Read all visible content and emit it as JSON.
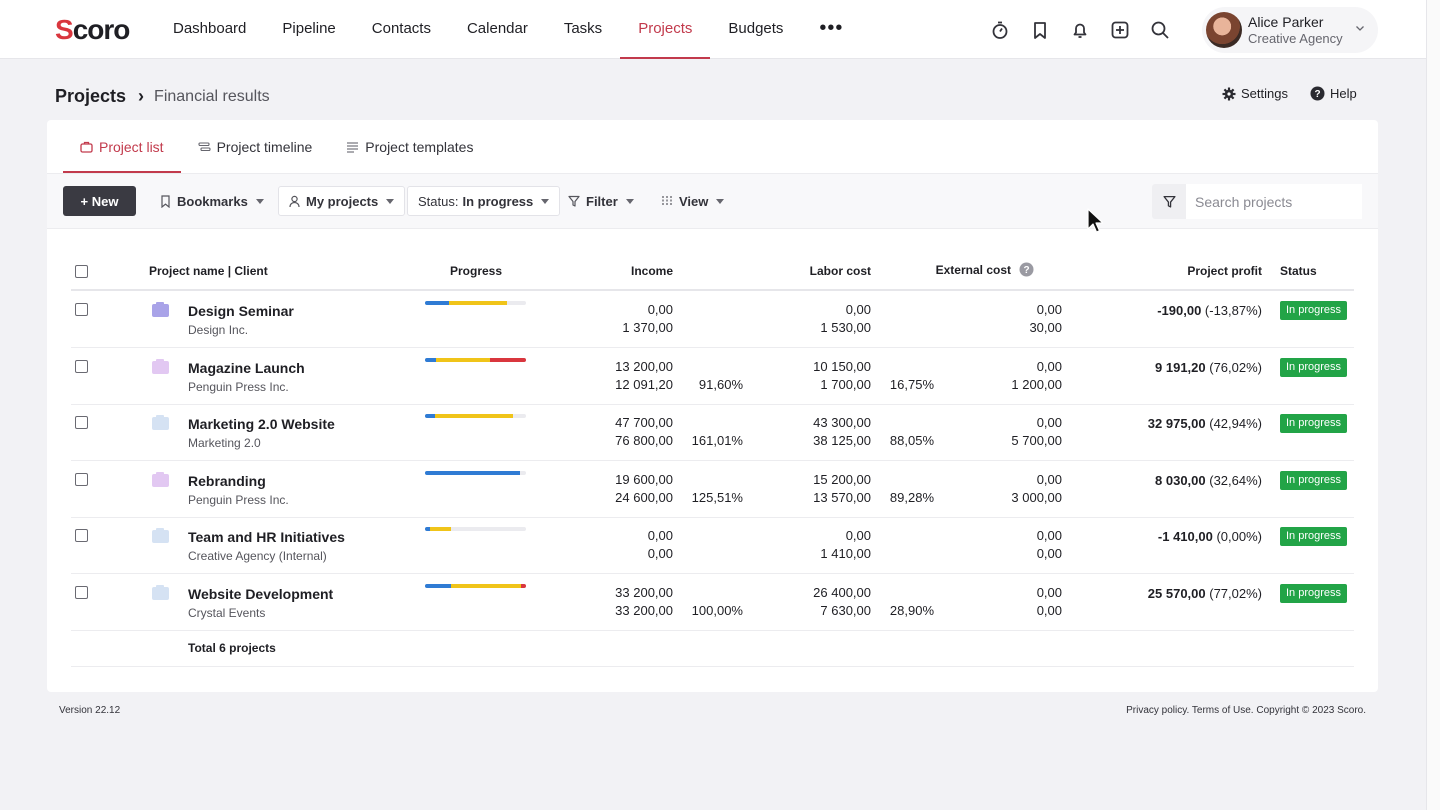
{
  "app": {
    "logo": "Scoro",
    "logo_initial": "S",
    "logo_rest": "coro"
  },
  "nav": {
    "items": [
      "Dashboard",
      "Pipeline",
      "Contacts",
      "Calendar",
      "Tasks",
      "Projects",
      "Budgets"
    ],
    "active": "Projects",
    "more": "•••"
  },
  "top_icons": [
    "stopwatch-icon",
    "bookmark-icon",
    "bell-icon",
    "add-square-icon",
    "search-icon"
  ],
  "user": {
    "name": "Alice Parker",
    "org": "Creative Agency"
  },
  "breadcrumb": {
    "root": "Projects",
    "sep": "›",
    "current": "Financial results"
  },
  "header_actions": {
    "settings": "Settings",
    "help": "Help"
  },
  "tabs": [
    "Project list",
    "Project timeline",
    "Project templates"
  ],
  "toolbar": {
    "new": "+ New",
    "bookmarks": "Bookmarks",
    "my_projects": "My projects",
    "status_label": "Status:",
    "status_value": "In progress",
    "filter": "Filter",
    "view": "View",
    "search_placeholder": "Search projects"
  },
  "table": {
    "headers": [
      "Project name | Client",
      "Progress",
      "Income",
      "Labor cost",
      "External cost",
      "Project profit",
      "Status"
    ],
    "rows": [
      {
        "name": "Design Seminar",
        "client": "Design Inc.",
        "folder_color": "#a9a3e8",
        "progress": [
          {
            "c": "#2f7bd4",
            "w": 0.24
          },
          {
            "c": "#f0c419",
            "w": 0.57
          }
        ],
        "income": [
          "0,00",
          "1 370,00"
        ],
        "income_pct": "",
        "labor": [
          "0,00",
          "1 530,00"
        ],
        "labor_pct": "",
        "external": [
          "0,00",
          "30,00"
        ],
        "profit": "-190,00",
        "profit_pct": "(-13,87%)",
        "status": "In progress"
      },
      {
        "name": "Magazine Launch",
        "client": "Penguin Press Inc.",
        "folder_color": "#e2c8f2",
        "progress": [
          {
            "c": "#2f7bd4",
            "w": 0.11
          },
          {
            "c": "#f0c419",
            "w": 0.53
          },
          {
            "c": "#d9363e",
            "w": 0.36
          }
        ],
        "income": [
          "13 200,00",
          "12 091,20"
        ],
        "income_pct": "91,60%",
        "labor": [
          "10 150,00",
          "1 700,00"
        ],
        "labor_pct": "16,75%",
        "external": [
          "0,00",
          "1 200,00"
        ],
        "profit": "9 191,20",
        "profit_pct": "(76,02%)",
        "status": "In progress"
      },
      {
        "name": "Marketing 2.0 Website",
        "client": "Marketing 2.0",
        "folder_color": "#d5e2f3",
        "progress": [
          {
            "c": "#2f7bd4",
            "w": 0.1
          },
          {
            "c": "#f0c419",
            "w": 0.77
          }
        ],
        "income": [
          "47 700,00",
          "76 800,00"
        ],
        "income_pct": "161,01%",
        "labor": [
          "43 300,00",
          "38 125,00"
        ],
        "labor_pct": "88,05%",
        "external": [
          "0,00",
          "5 700,00"
        ],
        "profit": "32 975,00",
        "profit_pct": "(42,94%)",
        "status": "In progress"
      },
      {
        "name": "Rebranding",
        "client": "Penguin Press Inc.",
        "folder_color": "#e2c8f2",
        "progress": [
          {
            "c": "#2f7bd4",
            "w": 0.94
          }
        ],
        "income": [
          "19 600,00",
          "24 600,00"
        ],
        "income_pct": "125,51%",
        "labor": [
          "15 200,00",
          "13 570,00"
        ],
        "labor_pct": "89,28%",
        "external": [
          "0,00",
          "3 000,00"
        ],
        "profit": "8 030,00",
        "profit_pct": "(32,64%)",
        "status": "In progress"
      },
      {
        "name": "Team and HR Initiatives",
        "client": "Creative Agency (Internal)",
        "folder_color": "#d5e2f3",
        "progress": [
          {
            "c": "#2f7bd4",
            "w": 0.05
          },
          {
            "c": "#f0c419",
            "w": 0.21
          }
        ],
        "income": [
          "0,00",
          "0,00"
        ],
        "income_pct": "",
        "labor": [
          "0,00",
          "1 410,00"
        ],
        "labor_pct": "",
        "external": [
          "0,00",
          "0,00"
        ],
        "profit": "-1 410,00",
        "profit_pct": "(0,00%)",
        "status": "In progress"
      },
      {
        "name": "Website Development",
        "client": "Crystal Events",
        "folder_color": "#d5e2f3",
        "progress": [
          {
            "c": "#2f7bd4",
            "w": 0.26
          },
          {
            "c": "#f0c419",
            "w": 0.69
          },
          {
            "c": "#d9363e",
            "w": 0.05
          }
        ],
        "income": [
          "33 200,00",
          "33 200,00"
        ],
        "income_pct": "100,00%",
        "labor": [
          "26 400,00",
          "7 630,00"
        ],
        "labor_pct": "28,90%",
        "external": [
          "0,00",
          "0,00"
        ],
        "profit": "25 570,00",
        "profit_pct": "(77,02%)",
        "status": "In progress"
      }
    ],
    "total": "Total 6 projects"
  },
  "footer": {
    "version": "Version 22.12",
    "legal": "Privacy policy. Terms of Use. Copyright © 2023 Scoro."
  },
  "colors": {
    "accent": "#c23a4c",
    "status_green": "#22a447",
    "dark_button": "#3a3a42"
  }
}
